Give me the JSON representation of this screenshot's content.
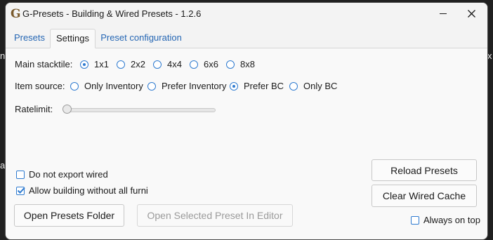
{
  "background": {
    "left_glyph_1": "n",
    "left_glyph_2": "a",
    "right_glyph": "x"
  },
  "window": {
    "title": "G-Presets - Building & Wired Presets - 1.2.6",
    "logo_letter": "G"
  },
  "tabs": [
    {
      "label": "Presets",
      "active": false
    },
    {
      "label": "Settings",
      "active": true
    },
    {
      "label": "Preset configuration",
      "active": false
    }
  ],
  "settings": {
    "main_stacktile": {
      "label": "Main stacktile:",
      "options": [
        "1x1",
        "2x2",
        "4x4",
        "6x6",
        "8x8"
      ],
      "selected": "1x1"
    },
    "item_source": {
      "label": "Item source:",
      "options": [
        "Only Inventory",
        "Prefer Inventory",
        "Prefer BC",
        "Only BC"
      ],
      "selected": "Prefer BC"
    },
    "ratelimit": {
      "label": "Ratelimit:",
      "value": 0
    },
    "do_not_export_wired": {
      "label": "Do not export wired",
      "checked": false
    },
    "allow_building": {
      "label": "Allow building without all furni",
      "checked": true
    },
    "always_on_top": {
      "label": "Always on top",
      "checked": false
    }
  },
  "buttons": {
    "open_presets_folder": "Open Presets Folder",
    "open_selected_preset": "Open Selected Preset In Editor",
    "reload_presets": "Reload Presets",
    "clear_wired_cache": "Clear Wired Cache"
  },
  "colors": {
    "accent": "#2f7bd0",
    "tab_link": "#2667b4",
    "window_bg": "#f9f9f9",
    "desktop_bg": "#202020"
  }
}
